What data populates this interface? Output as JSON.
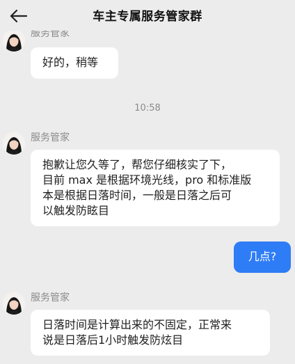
{
  "header": {
    "title": "车主专属服务管家群",
    "back_icon": "back-arrow-icon"
  },
  "messages": [
    {
      "sender": "服务管家",
      "direction": "incoming",
      "text": "好的，稍等"
    },
    {
      "type": "timestamp",
      "text": "10:58"
    },
    {
      "sender": "服务管家",
      "direction": "incoming",
      "lines": [
        "抱歉让您久等了，帮您仔细核实了下，",
        "目前 max 是根据环境光线，pro 和标准版",
        "本是根据日落时间，一般是日落之后可",
        "以触发防眩目"
      ]
    },
    {
      "direction": "outgoing",
      "text": "几点?"
    },
    {
      "sender": "服务管家",
      "direction": "incoming",
      "lines": [
        "日落时间是计算出来的不固定，正常来",
        "说是日落后1小时触发防炫目"
      ]
    }
  ],
  "colors": {
    "background": "#ececec",
    "incoming_bubble": "#ffffff",
    "outgoing_bubble": "#2e7cf6",
    "muted_text": "#8a8a8a"
  }
}
